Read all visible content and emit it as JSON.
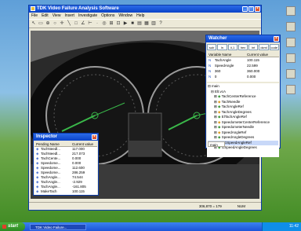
{
  "desktop": {
    "icons": [
      "icon-1",
      "icon-2",
      "icon-3",
      "icon-4",
      "icon-5",
      "icon-6"
    ]
  },
  "main_window": {
    "title": "TDK Video Failure Analysis Software",
    "menu": [
      "File",
      "Edit",
      "View",
      "Insert",
      "Investigate",
      "Options",
      "Window",
      "Help"
    ],
    "status_coords": "306,870 = 179",
    "status_mode": "NUM"
  },
  "watch_window": {
    "title": "Watcher",
    "buttons": [
      "sub",
      "ln",
      "ii,1",
      "hex",
      "int",
      "dcml",
      "code"
    ],
    "headers": [
      "Variable Name",
      "Current value"
    ],
    "rows": [
      [
        "N",
        "TachAngle",
        "100.115"
      ],
      [
        "N",
        "SpeedAngle",
        "22.599"
      ],
      [
        "N",
        "360",
        "360.000"
      ],
      [
        "N",
        "0",
        "0.000"
      ]
    ],
    "tree_root": "main",
    "tree_sub": "Elt.vcA",
    "tree": [
      "TachCenterReference",
      "TachNeedle",
      "TachAngleRef",
      "TachAngleDegrees",
      "ElTachAngleRef",
      "SpeedometerCenterReference",
      "SpeedometerNeedle",
      "SpeedAngleRef",
      "SpeedAngleDegrees",
      "SGSpeedAngleRef",
      "GSpeedAngleDegrees"
    ],
    "footer": "main"
  },
  "inspector_window": {
    "title": "Inspector",
    "headers": [
      "Pending Name",
      "Current value"
    ],
    "rows": [
      [
        "TachNeedl...",
        "117.000"
      ],
      [
        "TachNeedl...",
        "217.073"
      ],
      [
        "TachCente...",
        "0.000"
      ],
      [
        "Speedome...",
        "0.000"
      ],
      [
        "Speedome...",
        "112.600"
      ],
      [
        "Speedome...",
        "286.259"
      ],
      [
        "TachAngle...",
        "74.544"
      ],
      [
        "TachAngle...",
        "-2.929"
      ],
      [
        "TachAngle...",
        "-161.805"
      ],
      [
        "MakeTach",
        "100.115"
      ]
    ]
  },
  "taskbar": {
    "start": "start",
    "task": "TDK Video Failure...",
    "clock": "11:42"
  }
}
